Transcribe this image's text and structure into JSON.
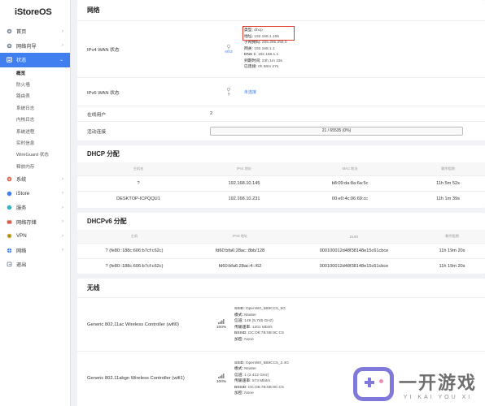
{
  "brand": "iStoreOS",
  "sidebar": {
    "items": [
      {
        "label": "首页",
        "icon": "gear-icon"
      },
      {
        "label": "网络向导",
        "icon": "gear-icon"
      },
      {
        "label": "状态",
        "icon": "status-icon"
      },
      {
        "label": "系统",
        "icon": "gear-icon"
      },
      {
        "label": "iStore",
        "icon": "gear-icon"
      },
      {
        "label": "服务",
        "icon": "gear-icon"
      },
      {
        "label": "网络存储",
        "icon": "gear-icon"
      },
      {
        "label": "VPN",
        "icon": "gear-icon"
      },
      {
        "label": "网络",
        "icon": "gear-icon"
      },
      {
        "label": "退出",
        "icon": "gear-icon"
      }
    ],
    "sub_items": [
      "概览",
      "防火墙",
      "路由表",
      "系统日志",
      "内核日志",
      "系统进程",
      "实时信息",
      "WireGuard 状态",
      "释放内存"
    ]
  },
  "network": {
    "title": "网络",
    "ipv4_label": "IPv4 WAN 状态",
    "ipv4_iface": "eth3",
    "ipv4_fields": [
      {
        "k": "类型:",
        "v": "dhcp"
      },
      {
        "k": "地址:",
        "v": "192.168.1.106"
      },
      {
        "k": "子网掩码:",
        "v": "255.255.255.0"
      },
      {
        "k": "网关:",
        "v": "192.168.1.1"
      },
      {
        "k": "DNS 1:",
        "v": "192.168.1.1"
      },
      {
        "k": "到期时间:",
        "v": "23h 1m 33s"
      },
      {
        "k": "已连接:",
        "v": "0h 58m 27s"
      }
    ],
    "ipv6_label": "IPv6 WAN 状态",
    "ipv6_iface": "?",
    "ipv6_status": "未连接",
    "online_label": "在线用户",
    "online_value": "2",
    "active_label": "活动连接",
    "active_value": "21 / 65535 (0%)",
    "active_fraction": 0.0003
  },
  "dhcp": {
    "title": "DHCP 分配",
    "headers": [
      "主机名",
      "IPv4 地址",
      "MAC 地址",
      "剩余租期"
    ],
    "rows": [
      [
        "?",
        "192.168.10.145",
        "b8:09:da:8a:6a:5c",
        "11h 5m 52s"
      ],
      [
        "DESKTOP-ICPQQU1",
        "192.168.10.231",
        "00:e0:4c:06:69:cc",
        "11h 1m 39s"
      ]
    ]
  },
  "dhcpv6": {
    "title": "DHCPv6 分配",
    "headers": [
      "主机",
      "IPv6 地址",
      "DUID",
      "剩余租期"
    ],
    "rows": [
      [
        "? (fe80::188c:606:b7cf:c62c)",
        "fd60:bfa6:28ac::8bb/128",
        "000100012d48f38148e15c61cbce",
        "11h 19m 20s"
      ],
      [
        "? (fe80::188c:606:b7cf:c62c)",
        "fd60:bfa6:28ac:4::/62",
        "000100012d48f38148e15c61cbce",
        "11h 19m 20s"
      ]
    ]
  },
  "wireless": {
    "title": "无线",
    "rows": [
      {
        "name": "Generic 802.11ac Wireless Controller (wifi0)",
        "signal": "100%",
        "fields": [
          {
            "k": "SSID:",
            "v": "OpenWrt_5B9CC6_5G",
            "link": true
          },
          {
            "k": "模式:",
            "v": "Master"
          },
          {
            "k": "信道:",
            "v": "149 (5.745 GHz)"
          },
          {
            "k": "传输速率:",
            "v": "1201 Mbit/s"
          },
          {
            "k": "BSSID:",
            "v": "DC:D8:7B:5B:9C:C6"
          },
          {
            "k": "加密:",
            "v": "None"
          }
        ]
      },
      {
        "name": "Generic 802.11abgn Wireless Controller (wifi1)",
        "signal": "100%",
        "fields": [
          {
            "k": "SSID:",
            "v": "OpenWrt_5B9CC5_2.4G",
            "link": true
          },
          {
            "k": "模式:",
            "v": "Master"
          },
          {
            "k": "信道:",
            "v": "1 (2.412 GHz)"
          },
          {
            "k": "传输速率:",
            "v": "573 Mbit/s"
          },
          {
            "k": "BSSID:",
            "v": "DC:D8:7B:5B:9C:C5"
          },
          {
            "k": "加密:",
            "v": "None"
          }
        ]
      }
    ]
  },
  "watermark": {
    "text": "一开游戏",
    "sub": "YI KAI YOU XI"
  }
}
